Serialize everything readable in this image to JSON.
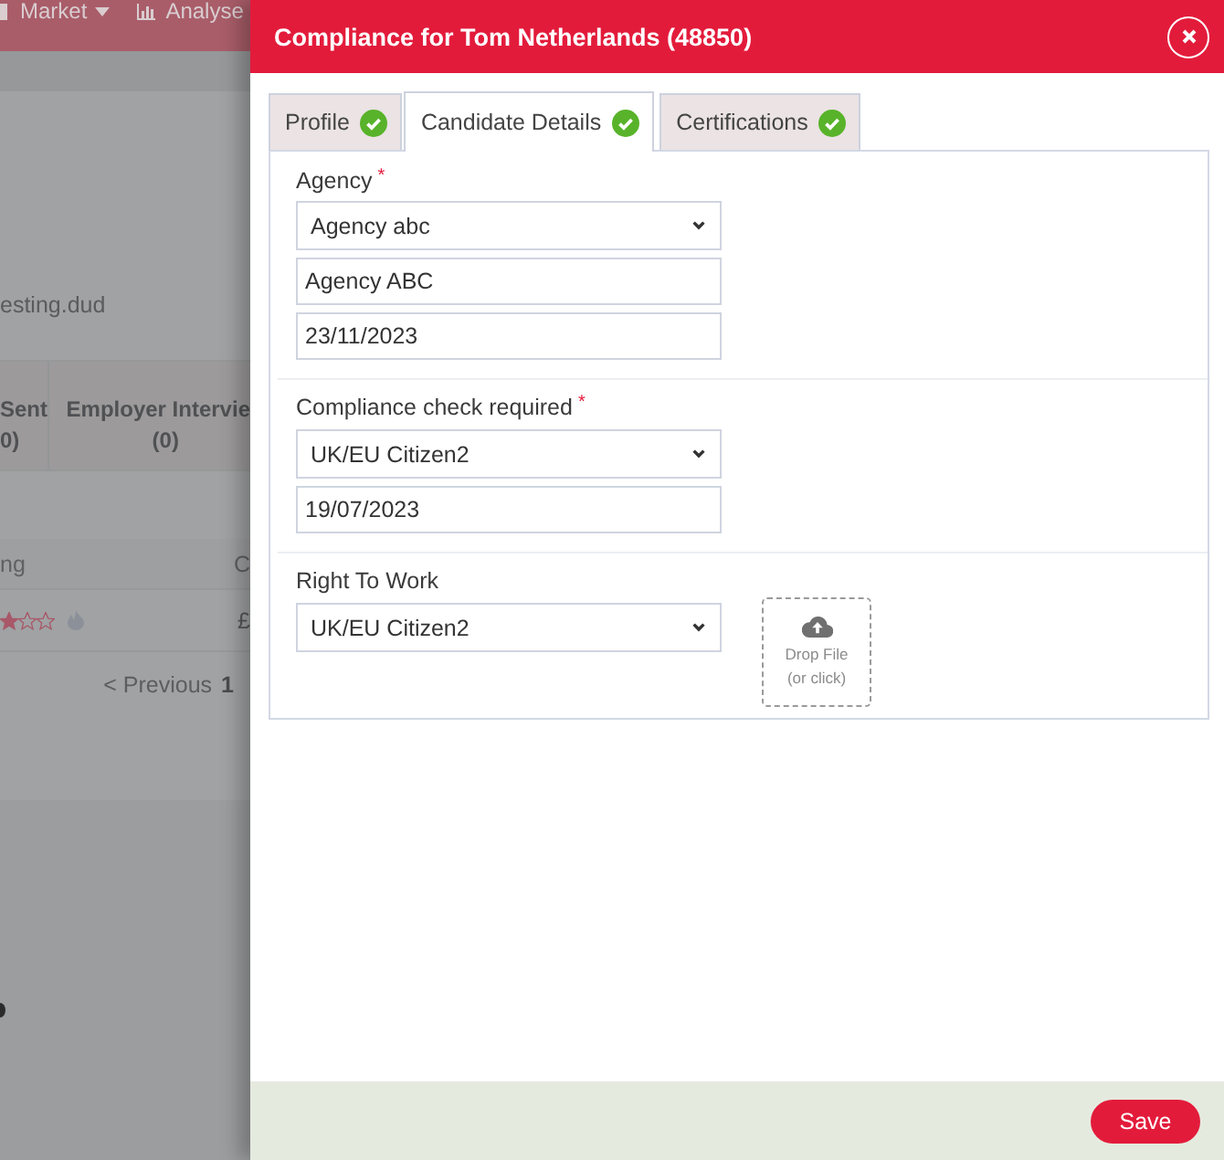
{
  "background_page": {
    "nav": [
      {
        "label": "Market",
        "kind": "dropdown"
      },
      {
        "label": "Analyse",
        "kind": "chart"
      }
    ],
    "email_fragment": "esting.dud",
    "stats": [
      {
        "label": "Sent",
        "count": "0)"
      },
      {
        "label": "Employer Intervie",
        "count": "(0)"
      }
    ],
    "table": {
      "columns": [
        "ng",
        "C"
      ],
      "rows": [
        {
          "stars": 1,
          "amount": "£"
        }
      ]
    },
    "pagination": {
      "previous": "< Previous",
      "page": "1"
    }
  },
  "modal": {
    "title": "Compliance for Tom Netherlands (48850)",
    "tabs": [
      {
        "label": "Profile",
        "selected": false,
        "complete": true
      },
      {
        "label": "Candidate Details",
        "selected": true,
        "complete": true
      },
      {
        "label": "Certifications",
        "selected": false,
        "complete": true
      }
    ],
    "sections": [
      {
        "label": "Agency",
        "required_mark": "*",
        "fields": [
          {
            "kind": "select",
            "value": "Agency abc"
          },
          {
            "kind": "text",
            "value": "Agency ABC"
          },
          {
            "kind": "date",
            "value": "23/11/2023"
          }
        ]
      },
      {
        "label": "Compliance check required",
        "required_mark": "*",
        "fields": [
          {
            "kind": "select",
            "value": "UK/EU Citizen2"
          },
          {
            "kind": "date",
            "value": "19/07/2023"
          }
        ]
      },
      {
        "label": "Right To Work",
        "fields": [
          {
            "kind": "select",
            "value": "UK/EU Citizen2"
          }
        ],
        "upload": {
          "lines": [
            "Drop File",
            "(or click)"
          ]
        }
      }
    ],
    "save_label": "Save"
  }
}
